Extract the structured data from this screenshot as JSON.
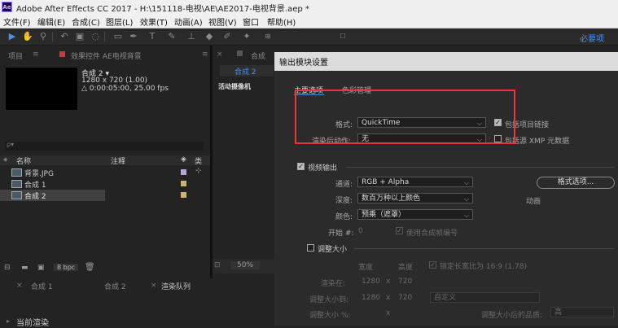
{
  "app": {
    "title": "Adobe After Effects CC 2017 - H:\\151118-电视\\AE\\AE2017-电视背景.aep *",
    "logo": "Ae"
  },
  "menu": [
    "文件(F)",
    "编辑(E)",
    "合成(C)",
    "图层(L)",
    "效果(T)",
    "动画(A)",
    "视图(V)",
    "窗口",
    "帮助(H)"
  ],
  "toolbar": {
    "essentials": "必要项",
    "icons": [
      "selection-icon",
      "hand-icon",
      "zoom-icon",
      "rotate-icon",
      "camera-icon",
      "pan-behind-icon",
      "rectangle-icon",
      "pen-icon",
      "type-icon",
      "brush-icon",
      "clone-stamp-icon",
      "eraser-icon",
      "roto-brush-icon",
      "puppet-icon"
    ]
  },
  "project_panel": {
    "tab_project": "项目",
    "tab_effects": "效果控件 AE电视背景",
    "comp_name": "合成 2 ▾",
    "comp_size": "1280 x 720 (1.00)",
    "comp_duration": "△ 0:00:05:00, 25.00 fps",
    "search_placeholder": "ρ▾",
    "columns": {
      "name": "名称",
      "comment": "注释",
      "type": "类"
    },
    "rows": [
      {
        "name": "背景.JPG",
        "icon": "image-icon",
        "color": "#b4a7d6",
        "selected": false
      },
      {
        "name": "合成 1",
        "icon": "composition-icon",
        "color": "#c8b27a",
        "selected": false
      },
      {
        "name": "合成 2",
        "icon": "composition-icon",
        "color": "#c8b27a",
        "selected": true
      }
    ],
    "bpc": "8 bpc"
  },
  "comp_panel": {
    "tab": "合成",
    "sub_tab": "合成 2",
    "camera_label": "活动摄像机",
    "zoom": "50%"
  },
  "bottom_tabs": [
    "合成 1",
    "合成 2",
    "渲染队列"
  ],
  "bottom_label": "当前渲染",
  "dialog": {
    "title": "输出模块设置",
    "tabs": [
      "主要选项",
      "色彩管理"
    ],
    "format_label": "格式:",
    "format_value": "QuickTime",
    "post_render_label": "渲染后动作:",
    "post_render_value": "无",
    "include_project_link": "包括项目链接",
    "include_xmp": "包括源 XMP 元数据",
    "video_output": "视频输出",
    "channels_label": "通道:",
    "channels_value": "RGB + Alpha",
    "depth_label": "深度:",
    "depth_value": "数百万种以上颜色",
    "color_label": "颜色:",
    "color_value": "预乘（遮罩）",
    "start_label": "开始 #:",
    "start_value": "0",
    "use_comp_frame": "使用合成帧编号",
    "format_options_button": "格式选项...",
    "animation": "动画",
    "resize": "调整大小",
    "width_header": "宽度",
    "height_header": "高度",
    "lock_aspect": "锁定长宽比为 16:9 (1.78)",
    "render_at_label": "渲染在:",
    "render_at_w": "1280",
    "render_at_h": "720",
    "resize_to_label": "调整大小到:",
    "resize_to_w": "1280",
    "resize_to_h": "720",
    "resize_to_value": "自定义",
    "resize_pct_label": "调整大小 %:",
    "resize_pct_x": "x",
    "resize_quality_label": "调整大小后的品质:",
    "resize_quality_value": "高"
  },
  "colors": {
    "accent": "#4e8fe0",
    "highlight": "#e53935"
  }
}
